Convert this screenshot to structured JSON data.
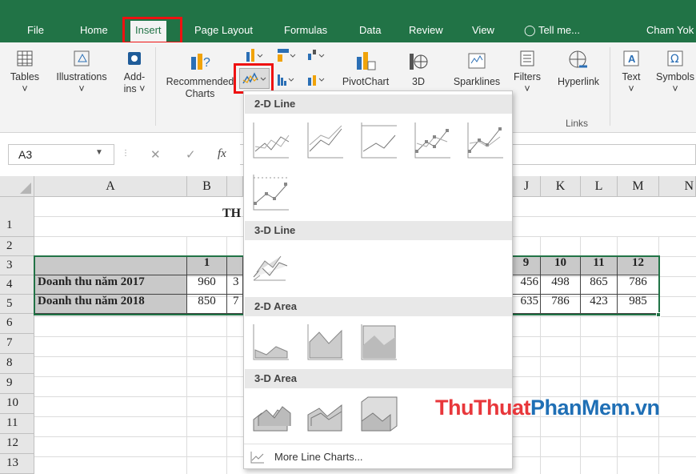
{
  "tabs": [
    "File",
    "Home",
    "Insert",
    "Page Layout",
    "Formulas",
    "Data",
    "Review",
    "View",
    "Tell me...",
    "Cham Yok"
  ],
  "ribbon": {
    "tables": "Tables",
    "illustrations": "Illustrations",
    "addins_1": "Add-",
    "addins_2": "ins",
    "recommended_1": "Recommended",
    "recommended_2": "Charts",
    "pivotchart": "PivotChart",
    "threed": "3D",
    "sparklines": "Sparklines",
    "filters": "Filters",
    "hyperlink": "Hyperlink",
    "links_group": "Links",
    "text": "Text",
    "symbols": "Symbols"
  },
  "formula_bar": {
    "name_box": "A3",
    "fx": "fx"
  },
  "sheet": {
    "columns": [
      "A",
      "B",
      "J",
      "K",
      "L",
      "M",
      "N"
    ],
    "rows": [
      "1",
      "2",
      "3",
      "4",
      "5",
      "6",
      "7",
      "8",
      "9",
      "10",
      "11",
      "12",
      "13"
    ],
    "title_partial": "TH",
    "header_months": {
      "b": "1",
      "j": "9",
      "k": "10",
      "l": "11",
      "m": "12"
    },
    "row4": {
      "label": "Doanh thu năm 2017",
      "b": "960",
      "c_partial": "3",
      "j": "456",
      "k": "498",
      "l": "865",
      "m": "786"
    },
    "row5": {
      "label": "Doanh thu năm 2018",
      "b": "850",
      "c_partial": "7",
      "j": "635",
      "k": "786",
      "l": "423",
      "m": "985"
    }
  },
  "dropdown": {
    "sections": [
      "2-D Line",
      "3-D Line",
      "2-D Area",
      "3-D Area"
    ],
    "more": "More Line Charts..."
  },
  "watermark": {
    "part1": "ThuThuat",
    "part2": "PhanMem",
    "part3": ".vn",
    "color1": "#e8373b",
    "color2": "#1f6fb5"
  },
  "colors": {
    "excel_green": "#217346",
    "highlight_red": "#e11111"
  }
}
